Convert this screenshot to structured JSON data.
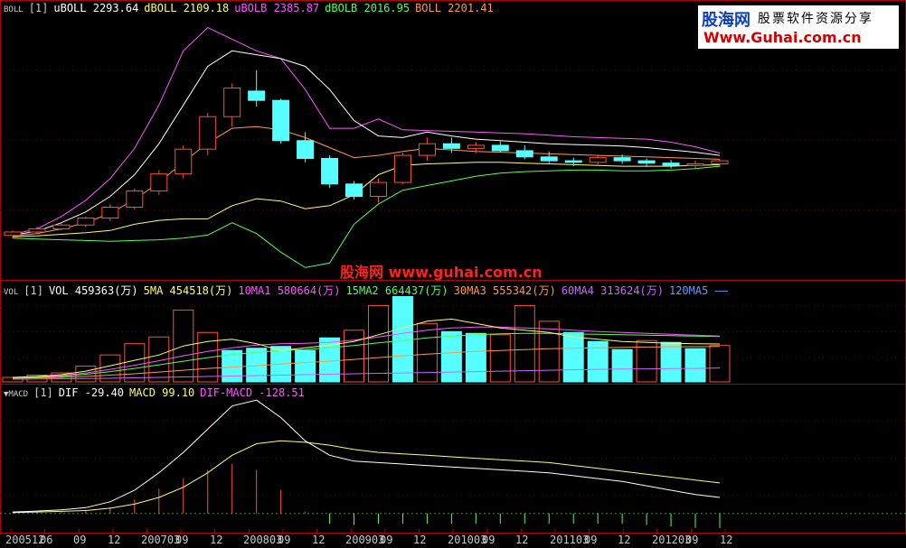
{
  "boll": {
    "tag": "BOLL",
    "param": "[1]",
    "legend": [
      {
        "text": "uBOLL 2293.64",
        "color": "#ffffff"
      },
      {
        "text": "dBOLL 2109.18",
        "color": "#ffff66"
      },
      {
        "text": "uBOLB 2385.87",
        "color": "#ff55ff"
      },
      {
        "text": "dBOLB 2016.95",
        "color": "#55ff55"
      },
      {
        "text": "BOLL 2201.41",
        "color": "#ff9944"
      }
    ]
  },
  "vol": {
    "tag": "VOL",
    "param": "[1]",
    "legend": [
      {
        "text": "VOL 459363(万)",
        "color": "#ffffff"
      },
      {
        "text": "5MA 454518(万)",
        "color": "#ffff66"
      },
      {
        "text": "10MA1 580664(万)",
        "color": "#ff55ff"
      },
      {
        "text": "15MA2 664437(万)",
        "color": "#55ff55"
      },
      {
        "text": "30MA3 555342(万)",
        "color": "#ff9944"
      },
      {
        "text": "60MA4 313624(万)",
        "color": "#cc66ff"
      },
      {
        "text": "120MA5 ——",
        "color": "#6699ff"
      }
    ]
  },
  "macd": {
    "tag": "▼MACD",
    "param": "[1]",
    "legend": [
      {
        "text": "DIF -29.40",
        "color": "#ffffff"
      },
      {
        "text": "MACD 99.10",
        "color": "#ffff66"
      },
      {
        "text": "DIF-MACD -128.51",
        "color": "#ff55ff"
      }
    ]
  },
  "logo": {
    "name": "股海网",
    "slogan": "股票软件资源分享",
    "url": "Www.Guhai.com.cn"
  },
  "watermark": "股海网 www.guhai.com.cn",
  "x_axis": [
    "200512",
    "06",
    "09",
    "12",
    "200703",
    "09",
    "12",
    "200803",
    "09",
    "12",
    "200903",
    "09",
    "12",
    "201003",
    "09",
    "12",
    "201103",
    "09",
    "12",
    "201203",
    "09",
    "12"
  ],
  "colors": {
    "frame": "#b00000",
    "up": "#ff5030",
    "down": "#55ffff",
    "text": "#c8c8c8"
  },
  "chart_data": [
    {
      "type": "candlestick",
      "panel": "BOLL",
      "candles": [
        {
          "o": 1115,
          "h": 1180,
          "l": 1080,
          "c": 1160
        },
        {
          "o": 1160,
          "h": 1230,
          "l": 1130,
          "c": 1200
        },
        {
          "o": 1200,
          "h": 1270,
          "l": 1180,
          "c": 1250
        },
        {
          "o": 1250,
          "h": 1360,
          "l": 1220,
          "c": 1340
        },
        {
          "o": 1340,
          "h": 1520,
          "l": 1300,
          "c": 1480
        },
        {
          "o": 1480,
          "h": 1720,
          "l": 1450,
          "c": 1690
        },
        {
          "o": 1690,
          "h": 1960,
          "l": 1640,
          "c": 1910
        },
        {
          "o": 1910,
          "h": 2280,
          "l": 1850,
          "c": 2230
        },
        {
          "o": 2230,
          "h": 2700,
          "l": 2150,
          "c": 2650
        },
        {
          "o": 2650,
          "h": 3080,
          "l": 2520,
          "c": 3020
        },
        {
          "o": 2980,
          "h": 3250,
          "l": 2780,
          "c": 2860
        },
        {
          "o": 2860,
          "h": 2880,
          "l": 2300,
          "c": 2340
        },
        {
          "o": 2340,
          "h": 2450,
          "l": 2060,
          "c": 2110
        },
        {
          "o": 2110,
          "h": 2150,
          "l": 1730,
          "c": 1780
        },
        {
          "o": 1780,
          "h": 1820,
          "l": 1580,
          "c": 1620
        },
        {
          "o": 1620,
          "h": 1850,
          "l": 1540,
          "c": 1800
        },
        {
          "o": 1800,
          "h": 2180,
          "l": 1780,
          "c": 2150
        },
        {
          "o": 2150,
          "h": 2380,
          "l": 2080,
          "c": 2300
        },
        {
          "o": 2300,
          "h": 2380,
          "l": 2180,
          "c": 2240
        },
        {
          "o": 2240,
          "h": 2320,
          "l": 2180,
          "c": 2280
        },
        {
          "o": 2280,
          "h": 2330,
          "l": 2190,
          "c": 2210
        },
        {
          "o": 2210,
          "h": 2280,
          "l": 2100,
          "c": 2130
        },
        {
          "o": 2130,
          "h": 2200,
          "l": 2050,
          "c": 2080
        },
        {
          "o": 2080,
          "h": 2120,
          "l": 2010,
          "c": 2060
        },
        {
          "o": 2060,
          "h": 2150,
          "l": 2010,
          "c": 2120
        },
        {
          "o": 2120,
          "h": 2160,
          "l": 2040,
          "c": 2080
        },
        {
          "o": 2080,
          "h": 2110,
          "l": 2000,
          "c": 2050
        },
        {
          "o": 2050,
          "h": 2090,
          "l": 1980,
          "c": 2020
        },
        {
          "o": 2020,
          "h": 2080,
          "l": 1980,
          "c": 2040
        },
        {
          "o": 2040,
          "h": 2100,
          "l": 2000,
          "c": 2080
        }
      ],
      "upper": [
        1120,
        1170,
        1280,
        1420,
        1620,
        1900,
        2300,
        2800,
        3300,
        3500,
        3450,
        3400,
        3300,
        3000,
        2600,
        2400,
        2380,
        2450,
        2400,
        2360,
        2340,
        2320,
        2300,
        2290,
        2280,
        2270,
        2250,
        2220,
        2190,
        2150
      ],
      "mid": [
        1110,
        1140,
        1200,
        1280,
        1400,
        1580,
        1800,
        2060,
        2310,
        2500,
        2520,
        2480,
        2380,
        2250,
        2120,
        2150,
        2200,
        2240,
        2220,
        2200,
        2190,
        2180,
        2170,
        2160,
        2150,
        2140,
        2130,
        2120,
        2110,
        2100
      ],
      "lower": [
        1100,
        1110,
        1130,
        1150,
        1180,
        1260,
        1310,
        1330,
        1330,
        1500,
        1590,
        1560,
        1460,
        1500,
        1640,
        1900,
        2020,
        2040,
        2050,
        2060,
        2060,
        2050,
        2040,
        2030,
        2020,
        2010,
        2010,
        2010,
        2020,
        2030
      ],
      "upper2": [
        1130,
        1200,
        1360,
        1570,
        1850,
        2240,
        2800,
        3500,
        3800,
        3650,
        3500,
        3400,
        3000,
        2500,
        2500,
        2620,
        2480,
        2470,
        2460,
        2450,
        2440,
        2430,
        2410,
        2390,
        2380,
        2370,
        2360,
        2320,
        2260,
        2180
      ],
      "lower2": [
        1080,
        1070,
        1060,
        1050,
        1040,
        1050,
        1060,
        1080,
        1120,
        1280,
        1140,
        900,
        700,
        760,
        1260,
        1520,
        1700,
        1760,
        1820,
        1880,
        1920,
        1940,
        1950,
        1960,
        1960,
        1950,
        1950,
        1960,
        1980,
        2010
      ],
      "ylim": [
        600,
        3900
      ]
    },
    {
      "type": "bar",
      "panel": "VOL",
      "values": [
        100000,
        150000,
        200000,
        350000,
        600000,
        850000,
        1000000,
        1600000,
        1100000,
        700000,
        750000,
        790000,
        700000,
        980000,
        1150000,
        1700000,
        1900000,
        1300000,
        1120000,
        1080000,
        1050000,
        1700000,
        1350000,
        1100000,
        900000,
        720000,
        920000,
        880000,
        740000,
        810000
      ],
      "up": [
        true,
        true,
        true,
        true,
        true,
        true,
        true,
        true,
        true,
        false,
        false,
        false,
        false,
        false,
        true,
        true,
        false,
        true,
        false,
        false,
        true,
        true,
        true,
        false,
        false,
        false,
        true,
        false,
        false,
        true
      ],
      "ma5": [
        100000,
        120000,
        160000,
        240000,
        360000,
        480000,
        600000,
        800000,
        900000,
        950000,
        850000,
        700000,
        760000,
        820000,
        900000,
        1050000,
        1200000,
        1350000,
        1400000,
        1300000,
        1200000,
        1150000,
        1100000,
        1000000,
        950000,
        900000,
        880000,
        860000,
        850000,
        845000
      ],
      "ma10": [
        100000,
        110000,
        140000,
        200000,
        280000,
        370000,
        470000,
        580000,
        680000,
        760000,
        820000,
        850000,
        860000,
        880000,
        930000,
        1000000,
        1080000,
        1150000,
        1200000,
        1220000,
        1220000,
        1200000,
        1180000,
        1150000,
        1120000,
        1100000,
        1080000,
        1060000,
        1040000,
        1020000
      ],
      "ma15": [
        90000,
        100000,
        120000,
        170000,
        230000,
        300000,
        380000,
        460000,
        540000,
        610000,
        660000,
        700000,
        720000,
        760000,
        810000,
        870000,
        920000,
        980000,
        1020000,
        1050000,
        1070000,
        1080000,
        1080000,
        1070000,
        1060000,
        1050000,
        1040000,
        1030000,
        1020000,
        1010000
      ],
      "ma30": [
        80000,
        90000,
        100000,
        120000,
        150000,
        180000,
        220000,
        260000,
        300000,
        330000,
        360000,
        400000,
        430000,
        460000,
        500000,
        540000,
        580000,
        620000,
        650000,
        680000,
        700000,
        720000,
        740000,
        750000,
        760000,
        770000,
        775000,
        780000,
        785000,
        790000
      ],
      "ma60": [
        60000,
        65000,
        70000,
        75000,
        80000,
        90000,
        100000,
        110000,
        120000,
        130000,
        140000,
        150000,
        160000,
        170000,
        180000,
        190000,
        200000,
        210000,
        220000,
        230000,
        240000,
        250000,
        260000,
        270000,
        280000,
        285000,
        290000,
        295000,
        300000,
        310000
      ],
      "ylim": [
        0,
        1950000
      ]
    },
    {
      "type": "line",
      "panel": "MACD",
      "dif": [
        5,
        8,
        12,
        20,
        40,
        80,
        140,
        210,
        290,
        370,
        390,
        330,
        250,
        200,
        180,
        175,
        170,
        165,
        160,
        155,
        150,
        145,
        140,
        130,
        120,
        110,
        95,
        80,
        65,
        55
      ],
      "dea": [
        3,
        5,
        7,
        10,
        18,
        32,
        55,
        90,
        140,
        200,
        240,
        250,
        245,
        235,
        220,
        210,
        205,
        200,
        195,
        190,
        185,
        180,
        175,
        165,
        155,
        145,
        135,
        125,
        115,
        105
      ],
      "hist": [
        2,
        3,
        5,
        10,
        22,
        48,
        85,
        120,
        150,
        170,
        150,
        80,
        5,
        -35,
        -40,
        -35,
        -35,
        -35,
        -35,
        -35,
        -35,
        -35,
        -35,
        -35,
        -35,
        -35,
        -40,
        -45,
        -50,
        -50
      ],
      "ylim": [
        -60,
        400
      ]
    }
  ]
}
